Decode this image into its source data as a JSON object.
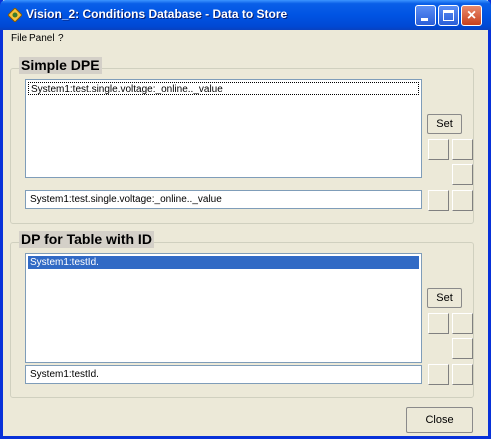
{
  "window": {
    "title": "Vision_2: Conditions Database - Data to Store",
    "app_icon": "vision-app-icon",
    "title_bg": "#0054e3"
  },
  "menu": {
    "items": [
      "File",
      "Panel",
      "?"
    ]
  },
  "simple_dpe": {
    "label": "Simple DPE",
    "list_items": [
      "System1:test.single.voltage:_online.._value"
    ],
    "field_value": "System1:test.single.voltage:_online.._value",
    "set_label": "Set"
  },
  "dp_table": {
    "label": "DP for Table with ID",
    "list_items": [
      "System1:testId."
    ],
    "field_value": "System1:testId.",
    "set_label": "Set",
    "selected_color": "#316ac5"
  },
  "close_label": "Close"
}
